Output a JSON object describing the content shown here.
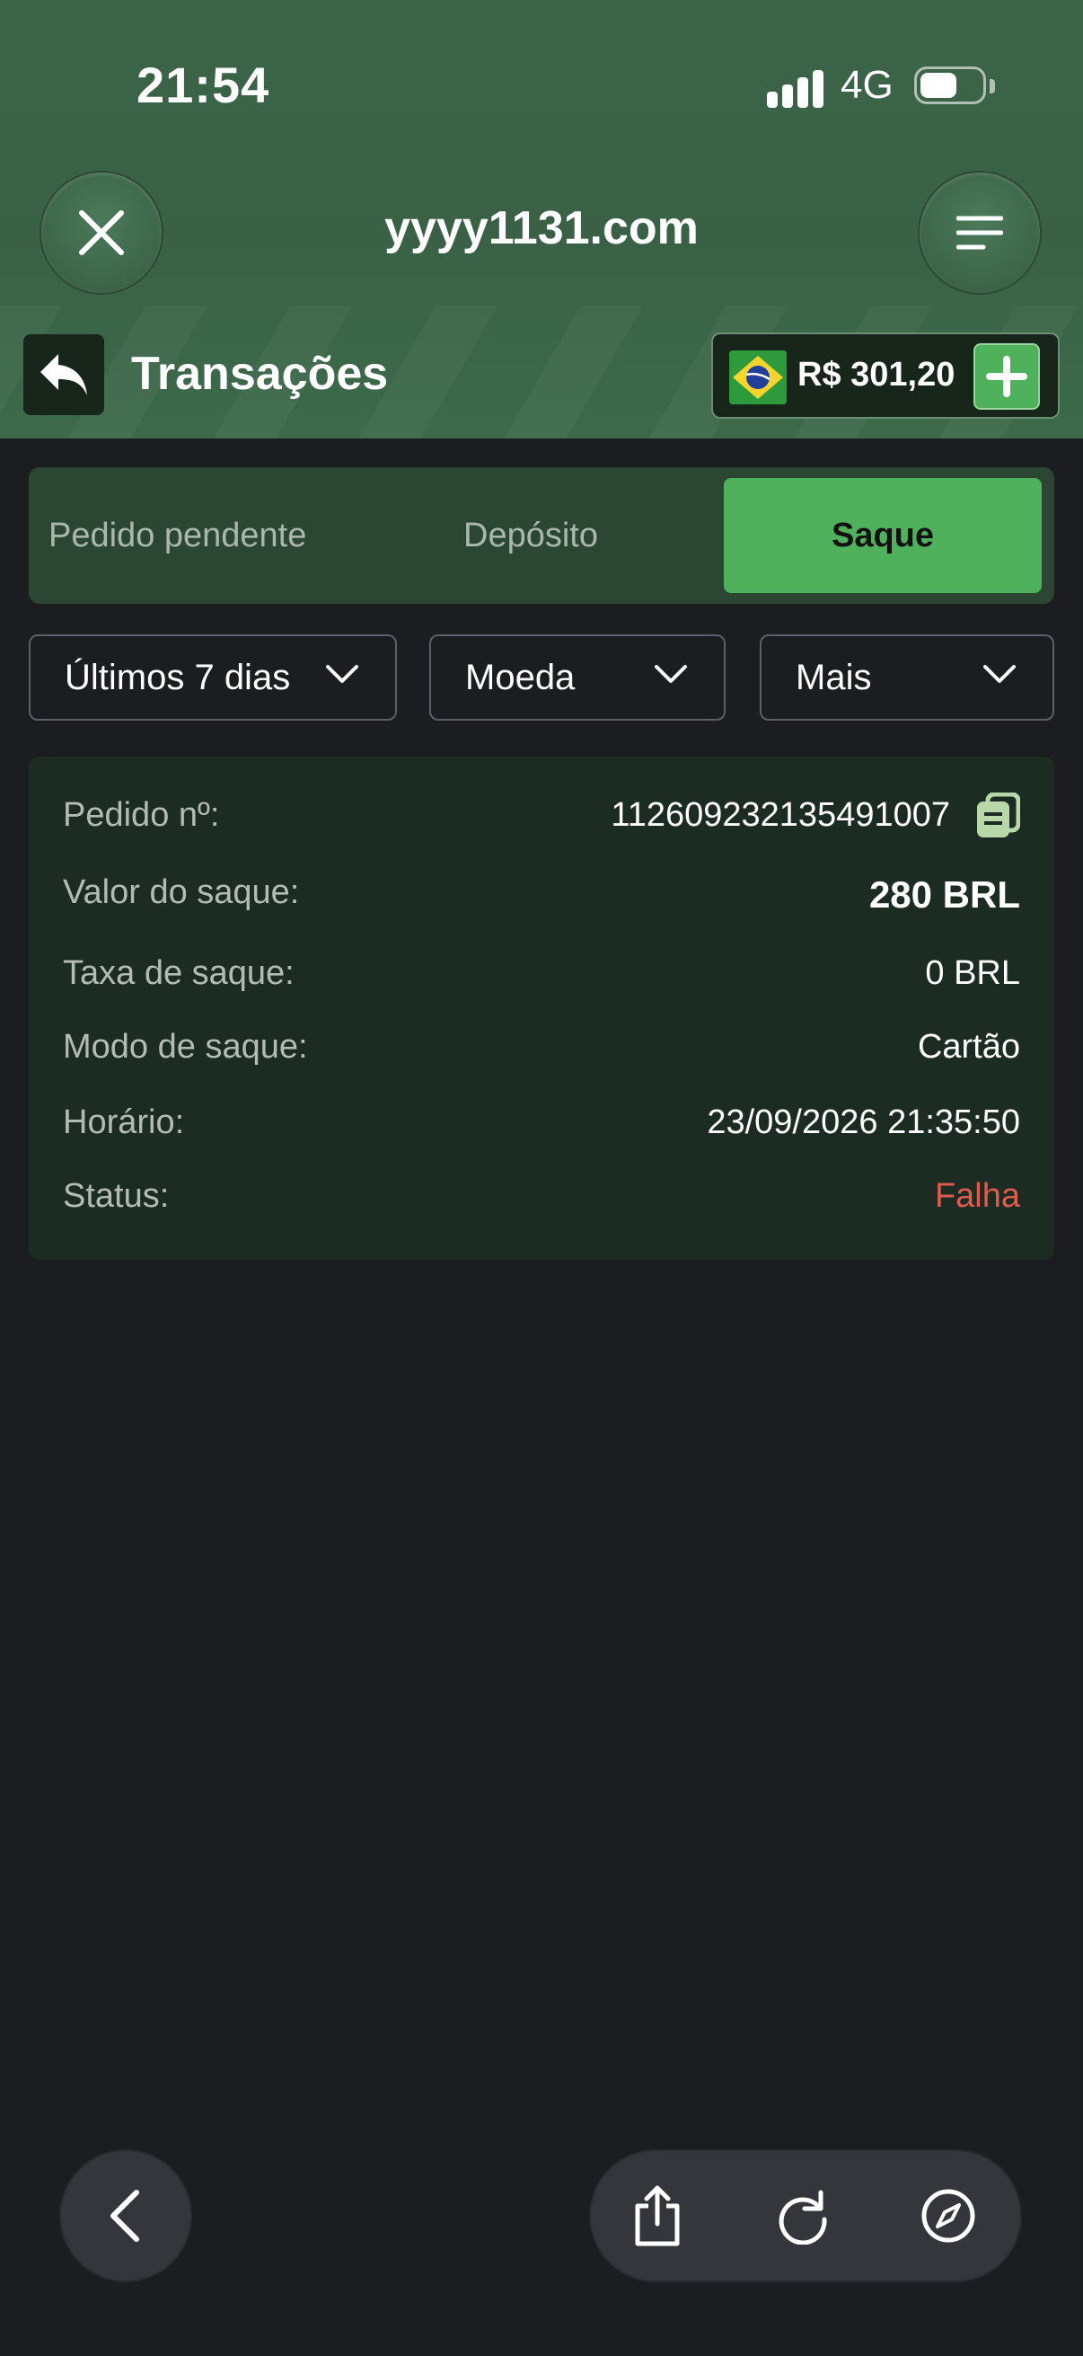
{
  "status_bar": {
    "time": "21:54",
    "network": "4G",
    "battery_level": 0.6
  },
  "browser": {
    "url": "yyyy1131.com"
  },
  "page": {
    "title": "Transações",
    "balance": "R$ 301,20"
  },
  "tabs": [
    {
      "label": "Pedido pendente",
      "active": false
    },
    {
      "label": "Depósito",
      "active": false
    },
    {
      "label": "Saque",
      "active": true
    }
  ],
  "filters": {
    "period": "Últimos 7 dias",
    "currency": "Moeda",
    "more": "Mais"
  },
  "transaction": {
    "order_label": "Pedido nº:",
    "order_value": "112609232135491007",
    "amount_label": "Valor do saque:",
    "amount_value": "280 BRL",
    "fee_label": "Taxa de saque:",
    "fee_value": "0 BRL",
    "mode_label": "Modo de saque:",
    "mode_value": "Cartão",
    "time_label": "Horário:",
    "time_value": "23/09/2026 21:35:50",
    "status_label": "Status:",
    "status_value": "Falha"
  },
  "colors": {
    "accent_green": "#4fb15c",
    "fail_red": "#e05a4e",
    "header_green": "#3a6146"
  },
  "icons": [
    "close-icon",
    "menu-icon",
    "reply-back-icon",
    "brazil-flag-icon",
    "plus-icon",
    "chevron-down-icon",
    "copy-icon",
    "chevron-left-icon",
    "share-icon",
    "reload-icon",
    "compass-icon"
  ]
}
